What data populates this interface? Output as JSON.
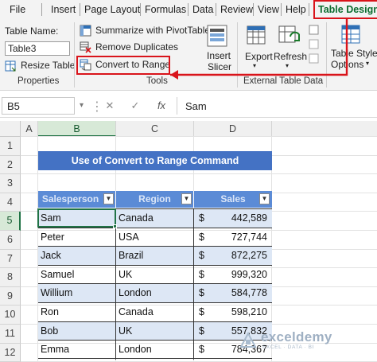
{
  "tabs": [
    "File",
    "Insert",
    "Page Layout",
    "Formulas",
    "Data",
    "Review",
    "View",
    "Help",
    "Table Design"
  ],
  "ribbon": {
    "properties": {
      "table_name_label": "Table Name:",
      "table_name_value": "Table3",
      "resize_label": "Resize Table",
      "group_label": "Properties"
    },
    "tools": {
      "summarize_label": "Summarize with PivotTable",
      "remove_dup_label": "Remove Duplicates",
      "convert_label": "Convert to Range",
      "slicer_label_1": "Insert",
      "slicer_label_2": "Slicer",
      "group_label": "Tools"
    },
    "external": {
      "export_label": "Export",
      "refresh_label": "Refresh",
      "group_label": "External Table Data"
    },
    "styles": {
      "label_1": "Table Style",
      "label_2": "Options"
    }
  },
  "formula_bar": {
    "name_box": "B5",
    "cancel": "✕",
    "enter": "✓",
    "fx": "fx",
    "value": "Sam"
  },
  "grid": {
    "columns": [
      "A",
      "B",
      "C",
      "D"
    ],
    "rows": [
      "1",
      "2",
      "3",
      "4",
      "5",
      "6",
      "7",
      "8",
      "9",
      "10",
      "11",
      "12"
    ],
    "title": "Use of Convert to Range Command",
    "headers": [
      "Salesperson",
      "Region",
      "Sales"
    ],
    "currency": "$",
    "records": [
      [
        "Sam",
        "Canada",
        "442,589"
      ],
      [
        "Peter",
        "USA",
        "727,744"
      ],
      [
        "Jack",
        "Brazil",
        "872,275"
      ],
      [
        "Samuel",
        "UK",
        "999,320"
      ],
      [
        "Willium",
        "London",
        "584,778"
      ],
      [
        "Ron",
        "Canada",
        "598,210"
      ],
      [
        "Bob",
        "UK",
        "557,832"
      ],
      [
        "Emma",
        "London",
        "784,367"
      ]
    ]
  },
  "watermark": {
    "name": "exceldemy",
    "tagline": "EXCEL · DATA · BI"
  },
  "colors": {
    "accent_red": "#d9141b",
    "design_green": "#0b6b2e",
    "excel_green": "#217346",
    "table_blue": "#4472c4",
    "header_blue": "#5b8bd6",
    "band_blue": "#dde7f5"
  }
}
